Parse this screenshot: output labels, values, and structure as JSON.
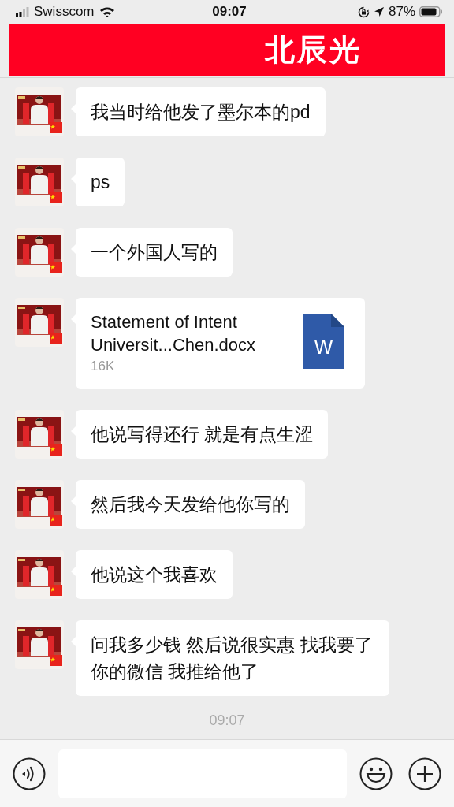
{
  "status_bar": {
    "carrier": "Swisscom",
    "time": "09:07",
    "battery": "87%"
  },
  "chat": {
    "title": "北辰光"
  },
  "messages": [
    {
      "kind": "text",
      "text": "我当时给他发了墨尔本的pd"
    },
    {
      "kind": "text",
      "text": "ps"
    },
    {
      "kind": "text",
      "text": "一个外国人写的"
    },
    {
      "kind": "file",
      "file_name": "Statement of Intent Universit...Chen.docx",
      "size": "16K",
      "file_icon": "W"
    },
    {
      "kind": "text",
      "text": "他说写得还行 就是有点生涩"
    },
    {
      "kind": "text",
      "text": "然后我今天发给他你写的"
    },
    {
      "kind": "text",
      "text": "他说这个我喜欢"
    },
    {
      "kind": "text",
      "text": "问我多少钱 然后说很实惠 找我要了你的微信 我推给他了"
    }
  ],
  "timestamp": "09:07"
}
